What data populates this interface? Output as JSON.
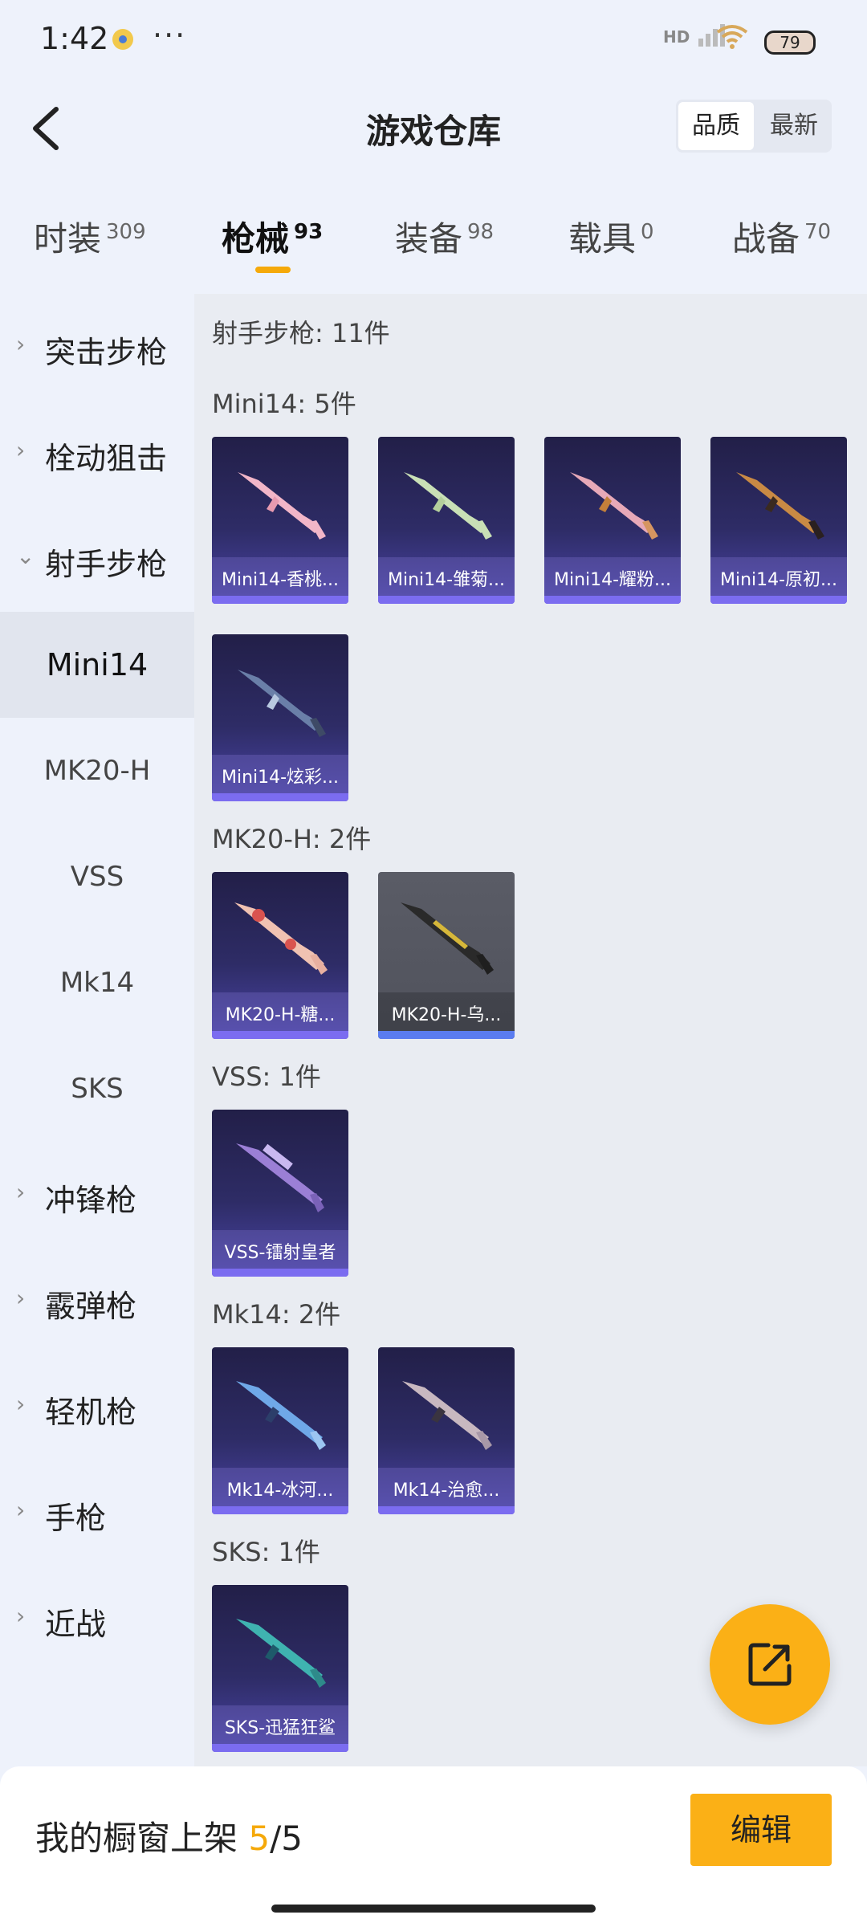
{
  "status": {
    "time": "1:42",
    "dots": "···",
    "hd": "HD",
    "battery": "79"
  },
  "header": {
    "title": "游戏仓库",
    "sort": [
      "品质",
      "最新"
    ]
  },
  "tabs": [
    {
      "label": "时装",
      "count": "309"
    },
    {
      "label": "枪械",
      "count": "93"
    },
    {
      "label": "装备",
      "count": "98"
    },
    {
      "label": "载具",
      "count": "0"
    },
    {
      "label": "战备",
      "count": "70"
    }
  ],
  "categories": {
    "assault": "突击步枪",
    "bolt": "栓动狙击",
    "dmr": "射手步枪",
    "dmr_subs": [
      "Mini14",
      "MK20-H",
      "VSS",
      "Mk14",
      "SKS"
    ],
    "smg": "冲锋枪",
    "shotgun": "霰弹枪",
    "lmg": "轻机枪",
    "pistol": "手枪",
    "melee": "近战"
  },
  "content": {
    "group_title": "射手步枪: 11件",
    "sections": [
      {
        "title": "Mini14: 5件",
        "items": [
          "Mini14-香桃...",
          "Mini14-雏菊...",
          "Mini14-耀粉...",
          "Mini14-原初...",
          "Mini14-炫彩..."
        ]
      },
      {
        "title": "MK20-H: 2件",
        "items": [
          "MK20-H-糖...",
          "MK20-H-乌..."
        ]
      },
      {
        "title": "VSS: 1件",
        "items": [
          "VSS-镭射皇者"
        ]
      },
      {
        "title": "Mk14: 2件",
        "items": [
          "Mk14-冰河...",
          "Mk14-治愈..."
        ]
      },
      {
        "title": "SKS: 1件",
        "items": [
          "SKS-迅猛狂鲨"
        ]
      }
    ]
  },
  "bottom": {
    "shelf_label": "我的橱窗上架",
    "shelf_current": "5",
    "shelf_total": "/5",
    "edit": "编辑"
  },
  "colors": {
    "accent": "#fbb016",
    "rarity_purple": "#7b6cf0",
    "card_bg": "#2e2c66"
  }
}
